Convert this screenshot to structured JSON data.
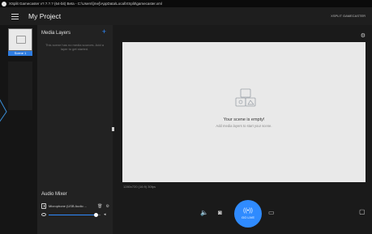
{
  "window": {
    "title": "XSplit Gamecaster v?.?.?.? (64-bit) Beta - C:\\Users\\[me]\\AppData\\Local\\XSplit\\gamecaster.xml"
  },
  "header": {
    "project_title": "My Project",
    "right_text": "XSPLIT GAMECASTER"
  },
  "scenes": {
    "active_label": "Scene 1"
  },
  "media_layers": {
    "heading": "Media Layers",
    "add_icon": "plus-icon",
    "hint": "This scene has no media sources. Add a layer to get started."
  },
  "audio_mixer": {
    "heading": "Audio Mixer",
    "device_label": "Microphone (USB Audio ...",
    "volume_level": 0.92
  },
  "stage": {
    "empty_title": "Your scene is empty!",
    "empty_subtitle": "Add media layers to start your scene.",
    "resolution_text": "1280x720 (16:9) 30fps"
  },
  "controls": {
    "go_live_label": "GO LIVE",
    "icons": [
      "speaker-icon",
      "camera-icon",
      "broadcast-icon",
      "webcam-icon",
      "chat-icon",
      "gear-icon"
    ]
  },
  "colors": {
    "accent": "#2f8bff",
    "scene_tag": "#2f7de1"
  }
}
